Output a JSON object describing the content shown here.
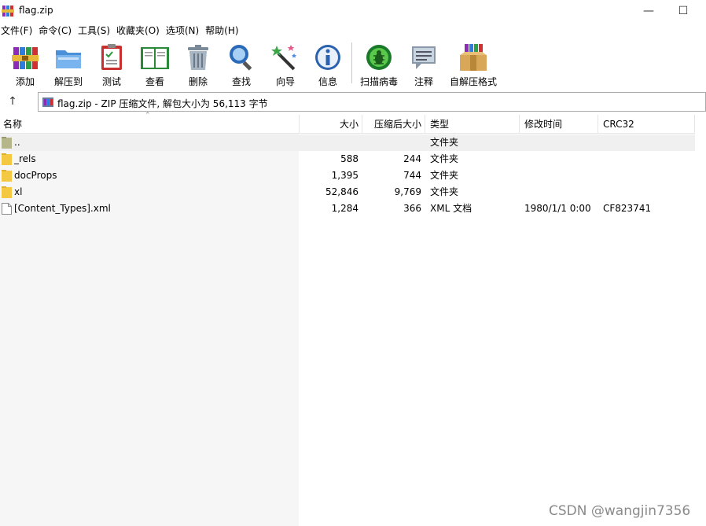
{
  "window": {
    "title": "flag.zip",
    "minimize_glyph": "—",
    "maximize_glyph": "☐"
  },
  "menu": [
    "文件(F)",
    "命令(C)",
    "工具(S)",
    "收藏夹(O)",
    "选项(N)",
    "帮助(H)"
  ],
  "toolbar": [
    {
      "label": "添加",
      "icon": "books-add-icon"
    },
    {
      "label": "解压到",
      "icon": "folder-extract-icon"
    },
    {
      "label": "测试",
      "icon": "clipboard-test-icon"
    },
    {
      "label": "查看",
      "icon": "book-view-icon"
    },
    {
      "label": "删除",
      "icon": "trash-can-icon"
    },
    {
      "label": "查找",
      "icon": "magnifier-icon"
    },
    {
      "label": "向导",
      "icon": "magic-wand-icon"
    },
    {
      "label": "信息",
      "icon": "info-icon"
    },
    {
      "label": "扫描病毒",
      "icon": "bug-scan-icon"
    },
    {
      "label": "注释",
      "icon": "comment-icon"
    },
    {
      "label": "自解压格式",
      "icon": "sfx-box-icon"
    }
  ],
  "address": {
    "up_glyph": "↑",
    "path": "flag.zip - ZIP 压缩文件, 解包大小为 56,113 字节"
  },
  "columns": {
    "name": "名称",
    "size": "大小",
    "packed": "压缩后大小",
    "type": "类型",
    "modified": "修改时间",
    "crc": "CRC32"
  },
  "files": [
    {
      "name": "..",
      "size": "",
      "packed": "",
      "type": "文件夹",
      "modified": "",
      "crc": "",
      "kind": "parent"
    },
    {
      "name": "_rels",
      "size": "588",
      "packed": "244",
      "type": "文件夹",
      "modified": "",
      "crc": "",
      "kind": "folder"
    },
    {
      "name": "docProps",
      "size": "1,395",
      "packed": "744",
      "type": "文件夹",
      "modified": "",
      "crc": "",
      "kind": "folder"
    },
    {
      "name": "xl",
      "size": "52,846",
      "packed": "9,769",
      "type": "文件夹",
      "modified": "",
      "crc": "",
      "kind": "folder"
    },
    {
      "name": "[Content_Types].xml",
      "size": "1,284",
      "packed": "366",
      "type": "XML 文档",
      "modified": "1980/1/1 0:00",
      "crc": "CF823741",
      "kind": "file"
    }
  ],
  "watermark": "CSDN @wangjin7356",
  "colors": {
    "folder": "#f5c842",
    "parent_folder": "#b5b68a",
    "row_highlight": "#f0f0f0"
  }
}
